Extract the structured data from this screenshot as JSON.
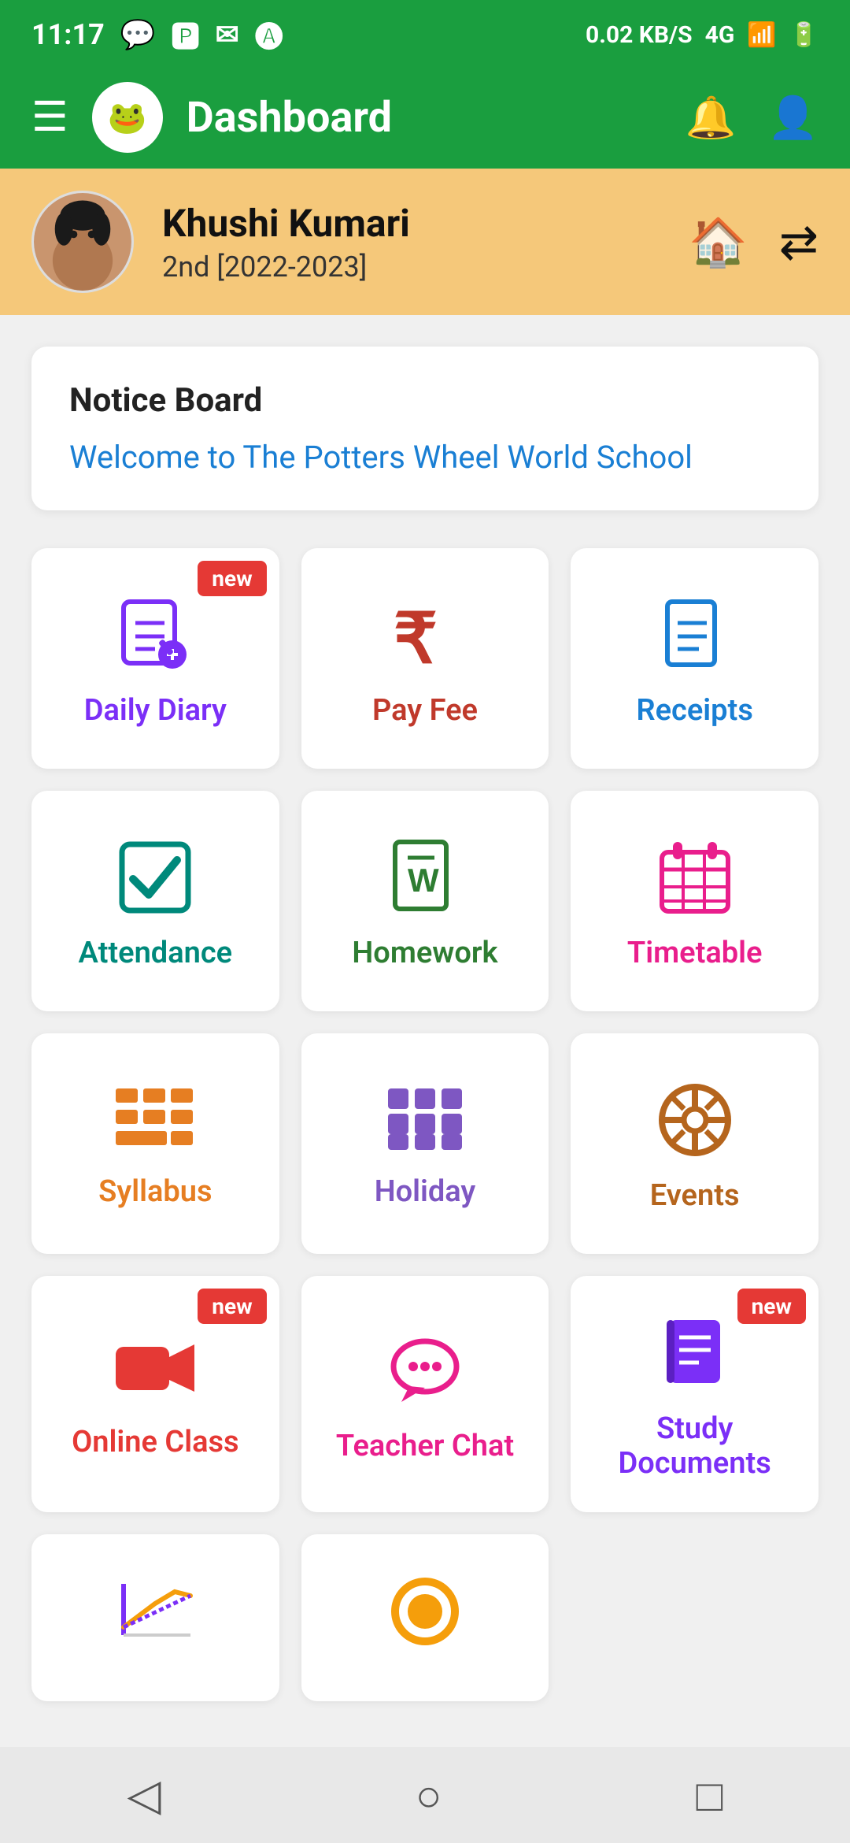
{
  "statusBar": {
    "time": "11:17",
    "network": "4G",
    "battery": "⚡",
    "speed": "0.02 KB/S"
  },
  "topNav": {
    "title": "Dashboard",
    "logo": "🐸"
  },
  "userBanner": {
    "name": "Khushi Kumari",
    "class": "2nd [2022-2023]"
  },
  "noticeBoard": {
    "title": "Notice Board",
    "text": "Welcome to The Potters Wheel World School"
  },
  "gridItems": [
    {
      "id": "daily-diary",
      "label": "Daily Diary",
      "color": "color-purple",
      "new": true,
      "icon": "diary"
    },
    {
      "id": "pay-fee",
      "label": "Pay Fee",
      "color": "color-red-dark",
      "new": false,
      "icon": "rupee"
    },
    {
      "id": "receipts",
      "label": "Receipts",
      "color": "color-blue",
      "new": false,
      "icon": "receipt"
    },
    {
      "id": "attendance",
      "label": "Attendance",
      "color": "color-teal",
      "new": false,
      "icon": "attendance"
    },
    {
      "id": "homework",
      "label": "Homework",
      "color": "color-green",
      "new": false,
      "icon": "homework"
    },
    {
      "id": "timetable",
      "label": "Timetable",
      "color": "color-pink",
      "new": false,
      "icon": "timetable"
    },
    {
      "id": "syllabus",
      "label": "Syllabus",
      "color": "color-orange",
      "new": false,
      "icon": "syllabus"
    },
    {
      "id": "holiday",
      "label": "Holiday",
      "color": "color-purple-light",
      "new": false,
      "icon": "holiday"
    },
    {
      "id": "events",
      "label": "Events",
      "color": "color-brown",
      "new": false,
      "icon": "events"
    },
    {
      "id": "online-class",
      "label": "Online Class",
      "color": "color-red",
      "new": true,
      "icon": "video"
    },
    {
      "id": "teacher-chat",
      "label": "Teacher Chat",
      "color": "color-magenta",
      "new": false,
      "icon": "chat"
    },
    {
      "id": "study-documents",
      "label": "Study\nDocuments",
      "color": "color-purple",
      "new": true,
      "icon": "book"
    }
  ],
  "partialItems": [
    {
      "id": "result",
      "label": "",
      "color": "color-purple",
      "icon": "chart"
    },
    {
      "id": "unknown",
      "label": "",
      "color": "color-orange",
      "icon": "circle"
    }
  ],
  "newBadgeLabel": "new",
  "bottomNav": {
    "back": "◁",
    "home": "○",
    "recent": "□"
  }
}
